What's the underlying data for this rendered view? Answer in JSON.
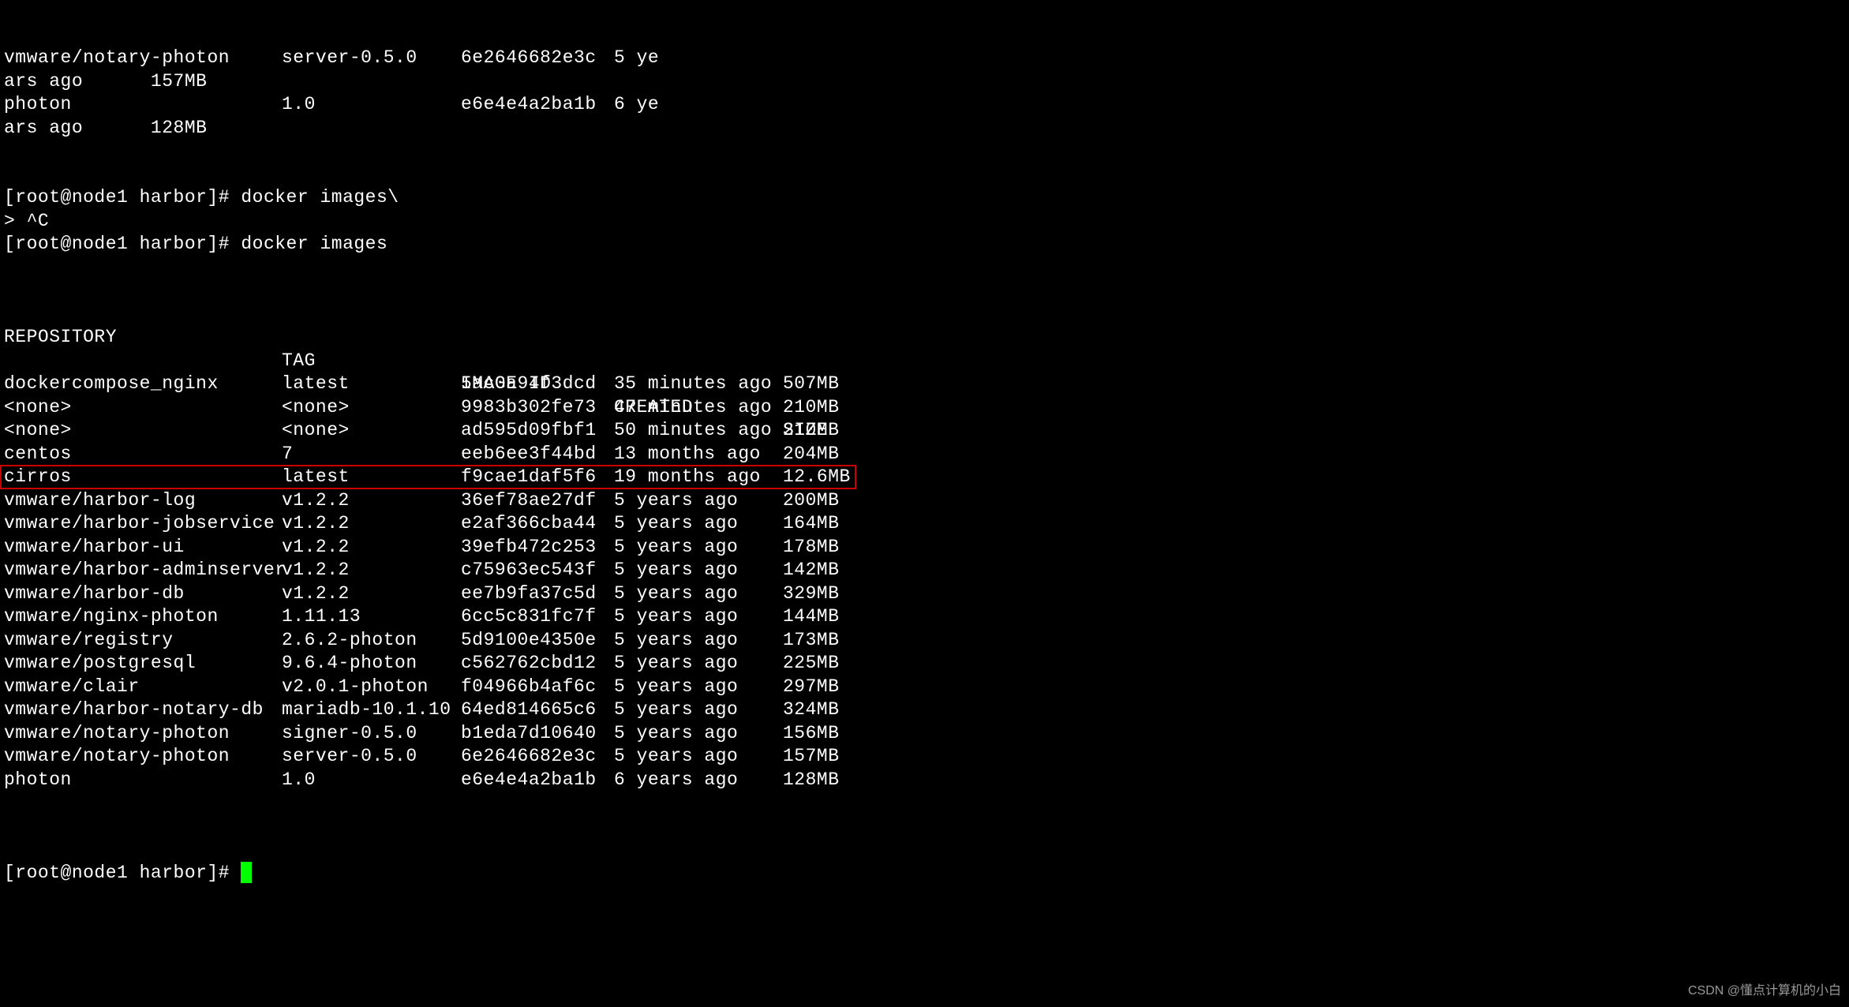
{
  "top_wrapped_lines": [
    {
      "repo": "vmware/notary-photon",
      "tag": "server-0.5.0",
      "imageid": "6e2646682e3c",
      "created_part": "5 ye"
    },
    "ars ago      157MB",
    {
      "repo": "photon",
      "tag": "1.0",
      "imageid": "e6e4e4a2ba1b",
      "created_part": "6 ye"
    },
    "ars ago      128MB"
  ],
  "prompt_lines": [
    "[root@node1 harbor]# docker images\\",
    "> ^C",
    "[root@node1 harbor]# docker images"
  ],
  "headers": {
    "repository": "REPOSITORY",
    "tag": "TAG",
    "imageid": "IMAGE ID",
    "created": "CREATED",
    "size": "SIZE"
  },
  "images": [
    {
      "repository": "dockercompose_nginx",
      "tag": "latest",
      "imageid": "5ac0a94f3dcd",
      "created": "35 minutes ago",
      "size": "507MB",
      "highlighted": false
    },
    {
      "repository": "<none>",
      "tag": "<none>",
      "imageid": "9983b302fe73",
      "created": "47 minutes ago",
      "size": "210MB",
      "highlighted": false
    },
    {
      "repository": "<none>",
      "tag": "<none>",
      "imageid": "ad595d09fbf1",
      "created": "50 minutes ago",
      "size": "210MB",
      "highlighted": false
    },
    {
      "repository": "centos",
      "tag": "7",
      "imageid": "eeb6ee3f44bd",
      "created": "13 months ago",
      "size": "204MB",
      "highlighted": false
    },
    {
      "repository": "cirros",
      "tag": "latest",
      "imageid": "f9cae1daf5f6",
      "created": "19 months ago",
      "size": "12.6MB",
      "highlighted": true
    },
    {
      "repository": "vmware/harbor-log",
      "tag": "v1.2.2",
      "imageid": "36ef78ae27df",
      "created": "5 years ago",
      "size": "200MB",
      "highlighted": false
    },
    {
      "repository": "vmware/harbor-jobservice",
      "tag": "v1.2.2",
      "imageid": "e2af366cba44",
      "created": "5 years ago",
      "size": "164MB",
      "highlighted": false
    },
    {
      "repository": "vmware/harbor-ui",
      "tag": "v1.2.2",
      "imageid": "39efb472c253",
      "created": "5 years ago",
      "size": "178MB",
      "highlighted": false
    },
    {
      "repository": "vmware/harbor-adminserver",
      "tag": "v1.2.2",
      "imageid": "c75963ec543f",
      "created": "5 years ago",
      "size": "142MB",
      "highlighted": false
    },
    {
      "repository": "vmware/harbor-db",
      "tag": "v1.2.2",
      "imageid": "ee7b9fa37c5d",
      "created": "5 years ago",
      "size": "329MB",
      "highlighted": false
    },
    {
      "repository": "vmware/nginx-photon",
      "tag": "1.11.13",
      "imageid": "6cc5c831fc7f",
      "created": "5 years ago",
      "size": "144MB",
      "highlighted": false
    },
    {
      "repository": "vmware/registry",
      "tag": "2.6.2-photon",
      "imageid": "5d9100e4350e",
      "created": "5 years ago",
      "size": "173MB",
      "highlighted": false
    },
    {
      "repository": "vmware/postgresql",
      "tag": "9.6.4-photon",
      "imageid": "c562762cbd12",
      "created": "5 years ago",
      "size": "225MB",
      "highlighted": false
    },
    {
      "repository": "vmware/clair",
      "tag": "v2.0.1-photon",
      "imageid": "f04966b4af6c",
      "created": "5 years ago",
      "size": "297MB",
      "highlighted": false
    },
    {
      "repository": "vmware/harbor-notary-db",
      "tag": "mariadb-10.1.10",
      "imageid": "64ed814665c6",
      "created": "5 years ago",
      "size": "324MB",
      "highlighted": false
    },
    {
      "repository": "vmware/notary-photon",
      "tag": "signer-0.5.0",
      "imageid": "b1eda7d10640",
      "created": "5 years ago",
      "size": "156MB",
      "highlighted": false
    },
    {
      "repository": "vmware/notary-photon",
      "tag": "server-0.5.0",
      "imageid": "6e2646682e3c",
      "created": "5 years ago",
      "size": "157MB",
      "highlighted": false
    },
    {
      "repository": "photon",
      "tag": "1.0",
      "imageid": "e6e4e4a2ba1b",
      "created": "6 years ago",
      "size": "128MB",
      "highlighted": false
    }
  ],
  "final_prompt": "[root@node1 harbor]# ",
  "watermark": "CSDN @懂点计算机的小白"
}
